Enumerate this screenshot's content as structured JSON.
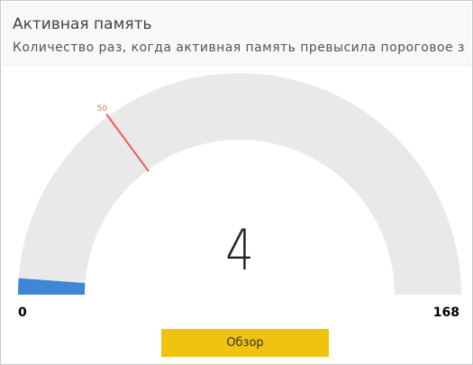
{
  "header": {
    "title": "Активная память",
    "subtitle": "Количество раз, когда активная память превысила пороговое з"
  },
  "gauge": {
    "value": 4,
    "value_label": "4",
    "min": 0,
    "max": 168,
    "min_label": "0",
    "max_label": "168",
    "target": 50,
    "target_label": "50",
    "colors": {
      "track": "#e9e9e9",
      "fill": "#3f86d6",
      "target": "#f05a57",
      "target_label": "#e0716d"
    }
  },
  "details_button": {
    "label": "Обзор",
    "color": "#f0c30f"
  }
}
